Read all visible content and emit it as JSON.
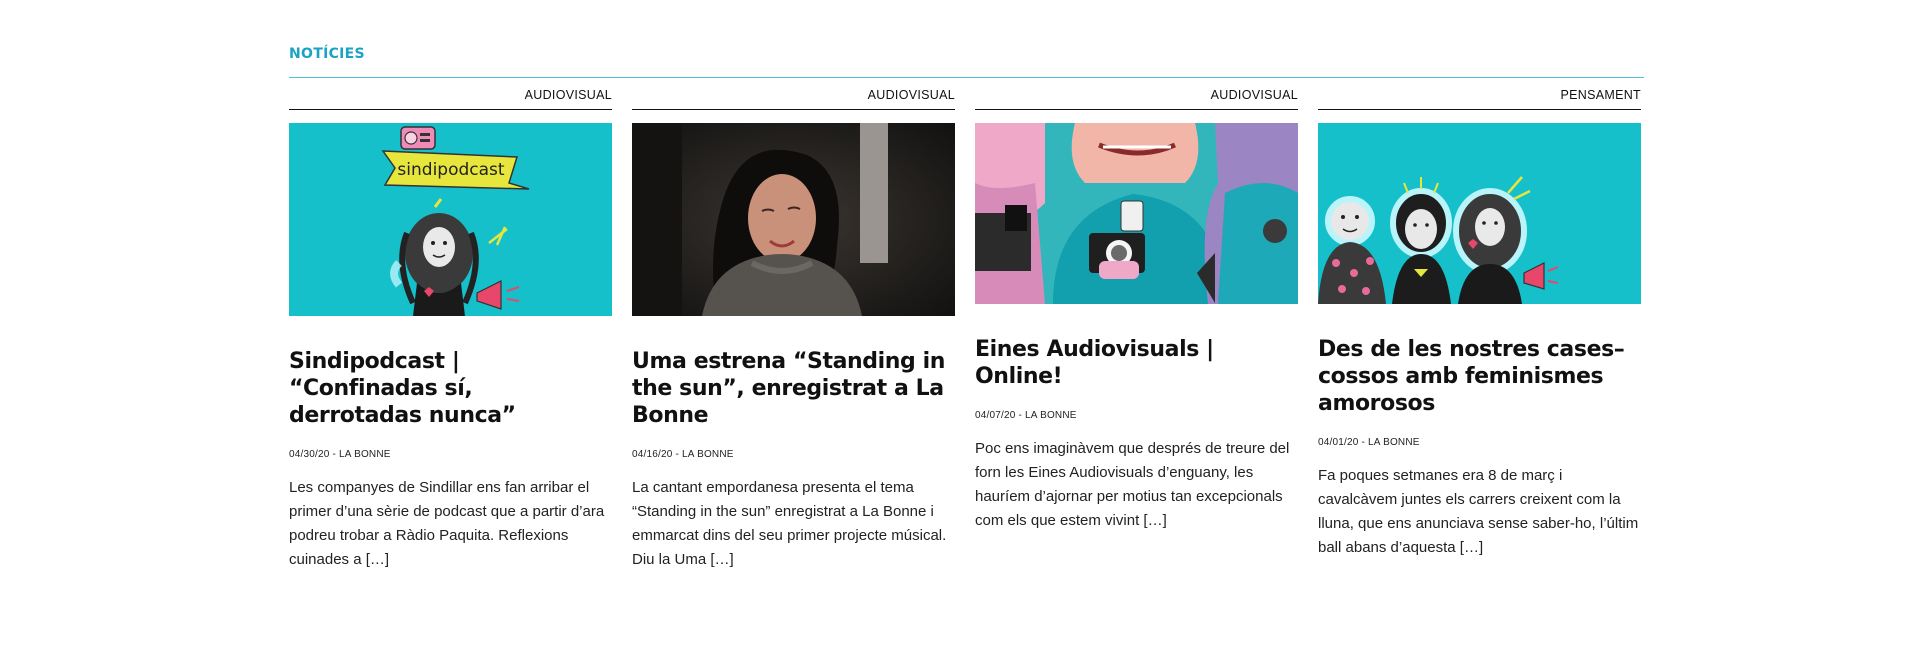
{
  "section": {
    "title": "NOTÍCIES"
  },
  "colors": {
    "accent": "#1aa3c3",
    "teal_bg": "#13bcc8",
    "pink": "#e86a9a"
  },
  "cards": [
    {
      "category": "AUDIOVISUAL",
      "image_label": "sindipodcast",
      "title": "Sindipodcast | “Confinadas sí, derrotadas nunca”",
      "date": "04/30/20",
      "separator": " - ",
      "author": "LA BONNE",
      "excerpt": "Les companyes de Sindillar ens fan arribar el primer d’una sèrie de podcast que a partir d’ara podreu trobar a Ràdio Paquita. Reflexions cuinades a […]"
    },
    {
      "category": "AUDIOVISUAL",
      "title": "Uma estrena “Standing in the sun”, enregistrat a La Bonne",
      "date": "04/16/20",
      "separator": " - ",
      "author": "LA BONNE",
      "excerpt": "La cantant empordanesa presenta el tema “Standing in the sun” enregistrat a La Bonne i emmarcat dins del seu primer projecte músical. Diu la Uma […]"
    },
    {
      "category": "AUDIOVISUAL",
      "title": "Eines Audiovisuals | Online!",
      "date": "04/07/20",
      "separator": " - ",
      "author": "LA BONNE",
      "excerpt": "Poc ens imaginàvem que després de treure del forn les Eines Audiovisuals d’enguany, les hauríem d’ajornar per motius tan excepcionals com els que estem vivint […]"
    },
    {
      "category": "PENSAMENT",
      "title": "Des de les nostres cases– cossos amb feminismes amorosos",
      "date": "04/01/20",
      "separator": " - ",
      "author": "LA BONNE",
      "excerpt": "Fa poques setmanes era 8 de març i cavalcàvem juntes els carrers creixent com la lluna, que ens anunciava sense saber-ho, l’últim ball abans d’aquesta […]"
    }
  ]
}
